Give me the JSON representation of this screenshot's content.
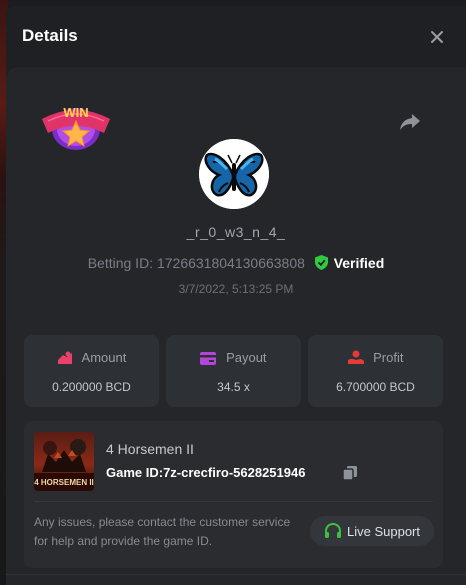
{
  "modal": {
    "title": "Details",
    "close_icon": "close-icon"
  },
  "bet": {
    "badge_text": "WIN",
    "username": "_r_0_w3_n_4_",
    "betting_id_label": "Betting ID:",
    "betting_id": "1726631804130663808",
    "verified_label": "Verified",
    "timestamp": "3/7/2022, 5:13:25 PM",
    "share_icon": "share-icon"
  },
  "stats": [
    {
      "label": "Amount",
      "value": "0.200000 BCD",
      "icon": "amount-icon",
      "color": "#e8416b"
    },
    {
      "label": "Payout",
      "value": "34.5 x",
      "icon": "payout-icon",
      "color": "#b445d8"
    },
    {
      "label": "Profit",
      "value": "6.700000 BCD",
      "icon": "profit-icon",
      "color": "#e23b3b"
    }
  ],
  "game": {
    "name": "4 Horsemen II",
    "thumb_text": "4 HORSEMEN II",
    "game_id_label": "Game ID:",
    "game_id": "7z-crecfiro-5628251946",
    "copy_icon": "copy-icon",
    "support_text": "Any issues, please contact the customer service for help and provide the game ID.",
    "support_button": "Live Support"
  },
  "colors": {
    "verified_green": "#2ecc40",
    "support_green": "#3fbf3f"
  }
}
